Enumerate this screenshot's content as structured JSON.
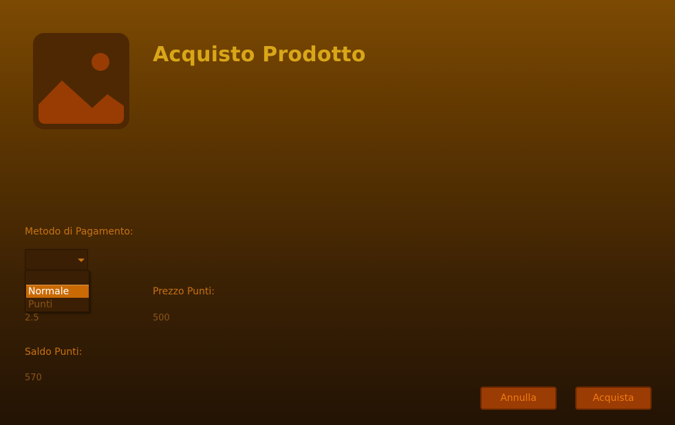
{
  "header": {
    "title": "Acquisto Prodotto",
    "image_icon": "image-placeholder-icon"
  },
  "payment": {
    "label": "Metodo di Pagamento:",
    "selected": "",
    "options": [
      "Normale",
      "Punti"
    ],
    "highlighted_option": "Normale"
  },
  "price": {
    "value": "2.5"
  },
  "points_price": {
    "label": "Prezzo Punti:",
    "value": "500"
  },
  "balance": {
    "label": "Saldo Punti:",
    "value": "570"
  },
  "buttons": {
    "cancel": "Annulla",
    "buy": "Acquista"
  },
  "colors": {
    "accent": "#c96a04",
    "title": "#d9a618",
    "button_bg": "#9a3c03"
  }
}
